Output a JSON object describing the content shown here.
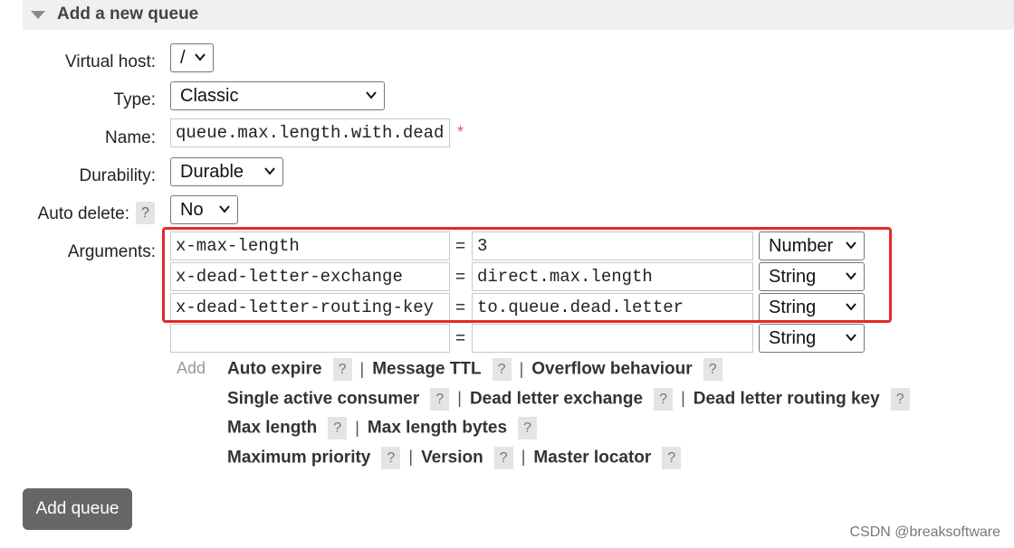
{
  "section": {
    "title": "Add a new queue"
  },
  "fields": {
    "virtual_host": {
      "label": "Virtual host:",
      "value": "/"
    },
    "type": {
      "label": "Type:",
      "value": "Classic"
    },
    "name": {
      "label": "Name:",
      "value": "queue.max.length.with.dead",
      "required_mark": "*"
    },
    "durability": {
      "label": "Durability:",
      "value": "Durable"
    },
    "auto_delete": {
      "label": "Auto delete:",
      "help": "?",
      "value": "No"
    }
  },
  "arguments": {
    "label": "Arguments:",
    "eq": "=",
    "rows": [
      {
        "key": "x-max-length",
        "value": "3",
        "type": "Number"
      },
      {
        "key": "x-dead-letter-exchange",
        "value": "direct.max.length",
        "type": "String"
      },
      {
        "key": "x-dead-letter-routing-key",
        "value": "to.queue.dead.letter",
        "type": "String"
      },
      {
        "key": "",
        "value": "",
        "type": "String"
      }
    ],
    "add_label": "Add"
  },
  "shortcuts": {
    "help": "?",
    "sep": "|",
    "lines": [
      [
        "Auto expire",
        "Message TTL",
        "Overflow behaviour"
      ],
      [
        "Single active consumer",
        "Dead letter exchange",
        "Dead letter routing key"
      ],
      [
        "Max length",
        "Max length bytes"
      ],
      [
        "Maximum priority",
        "Version",
        "Master locator"
      ]
    ]
  },
  "submit": {
    "label": "Add queue"
  },
  "watermark": "CSDN @breaksoftware",
  "colors": {
    "highlight": "#e62828",
    "button_bg": "#666666",
    "required": "#ee5555"
  }
}
